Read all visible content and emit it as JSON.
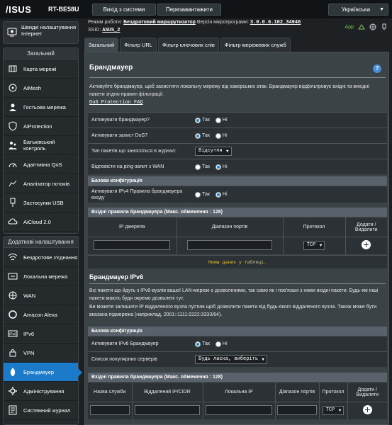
{
  "header": {
    "logo": "/ISUS",
    "model": "RT-BE58U",
    "logout_label": "Вихід з системи",
    "reboot_label": "Перезавантажити",
    "language": "Українська"
  },
  "info": {
    "mode_label": "Режим роботи:",
    "mode_value": "Бездротовий маршрутизатор",
    "fw_label": "Версія мікропрограми:",
    "fw_value": "3.0.0.6.102_34946",
    "ssid_label": "SSID:",
    "ssid_value": "ASUS_2",
    "app_label": "App"
  },
  "sidebar": {
    "quick_label": "Швидкі налаштування Інтернет",
    "general_heading": "Загальний",
    "general_items": [
      {
        "label": "Карта мережі",
        "icon": "map-icon"
      },
      {
        "label": "AiMesh",
        "icon": "aimesh-icon"
      },
      {
        "label": "Гостьова мережа",
        "icon": "guest-icon"
      },
      {
        "label": "AiProtection",
        "icon": "shield-icon"
      },
      {
        "label": "Батьківський контроль",
        "icon": "parental-icon"
      },
      {
        "label": "Адаптивна QoS",
        "icon": "qos-icon"
      },
      {
        "label": "Аналізатор потоків",
        "icon": "traffic-icon"
      },
      {
        "label": "Застосунки USB",
        "icon": "usb-icon"
      },
      {
        "label": "AiCloud 2.0",
        "icon": "cloud-icon"
      }
    ],
    "advanced_heading": "Додаткові налаштування",
    "advanced_items": [
      {
        "label": "Бездротове з'єднання",
        "icon": "wifi-icon"
      },
      {
        "label": "Локальна мережа",
        "icon": "lan-icon"
      },
      {
        "label": "WAN",
        "icon": "wan-icon"
      },
      {
        "label": "Amazon Alexa",
        "icon": "alexa-icon"
      },
      {
        "label": "IPv6",
        "icon": "ipv6-icon"
      },
      {
        "label": "VPN",
        "icon": "vpn-icon"
      },
      {
        "label": "Брандмауер",
        "icon": "firewall-icon",
        "active": true
      },
      {
        "label": "Адміністрування",
        "icon": "admin-icon"
      },
      {
        "label": "Системний журнал",
        "icon": "log-icon"
      }
    ]
  },
  "tabs": [
    "Загальний",
    "Фільтр URL",
    "Фільтр ключових слів",
    "Фільтр мережевих служб"
  ],
  "firewall": {
    "title": "Брандмауер",
    "help": "?",
    "description": "Активуйте брандмауер, щоб захистити локальну мережу від хакерських атак. Брандмауер відфільтровує вхідні та вихідні пакети згідно правил фільтрації.",
    "faq": "DoS Protection FAQ",
    "rows": [
      {
        "label": "Активувати брандмауер?",
        "type": "radio",
        "yes": "Так",
        "no": "Ні",
        "selected": "yes"
      },
      {
        "label": "Активувати захист DoS?",
        "type": "radio",
        "yes": "Так",
        "no": "Ні",
        "selected": "yes"
      },
      {
        "label": "Тип пакетів що заносяться в журнал:",
        "type": "select",
        "value": "Відсутня"
      },
      {
        "label": "Відповісти на ping-запит з WAN",
        "type": "radio",
        "yes": "Так",
        "no": "Ні",
        "selected": "no"
      }
    ],
    "basic_config": "Базова конфігурація",
    "ipv4_rules_label": "Активувати IPv4 Правила брандмауера входу",
    "ipv4_rules_yes": "Так",
    "ipv4_rules_no": "Ні",
    "ipv4_rules_selected": "no",
    "inbound_heading": "Вхідні правила брандмауера (Макс. обмеження : 128)",
    "inbound_columns": [
      "IP джерела",
      "Діапазон портів",
      "Протокол",
      "Додати / Видалити"
    ],
    "inbound_protocol": "TCP",
    "no_data": "Нема даних у таблиці."
  },
  "firewall6": {
    "title": "Брандмауер IPv6",
    "description": "Всі пакети що йдуть з IPv6-вузлів вашої LAN-мережі є дозволеними, так само як і пов'язані з ними вхідні пакети. Будь-які інші пакети мають буди окремо дозволені тут.",
    "description2": "Ви можете залишити IP віддаленого вузла пустим щоб дозволити пакети від будь-якого віддаленого вузла. Також може бути вказана підмережа (наприклад, 2001::1111:2222:3333/64).",
    "basic_config": "Базова конфігурація",
    "enable_label": "Активувати IPv6 Брандмауер",
    "enable_yes": "Так",
    "enable_no": "Ні",
    "enable_selected": "yes",
    "servers_label": "Список популярних серверів",
    "servers_value": "Будь ласка, виберіть",
    "inbound_heading": "Вхідні правила брандмауера (Макс. обмеження : 128)",
    "inbound_columns": [
      "Назва служби",
      "Віддалений IP/CIDR",
      "Локальна IP",
      "Діапазон портів",
      "Протокол",
      "Додати / Видалити"
    ],
    "inbound_protocol": "TCP"
  },
  "colors": {
    "accent": "#1c7acb",
    "warning": "#e8c23a",
    "app_green": "#7fc455"
  }
}
